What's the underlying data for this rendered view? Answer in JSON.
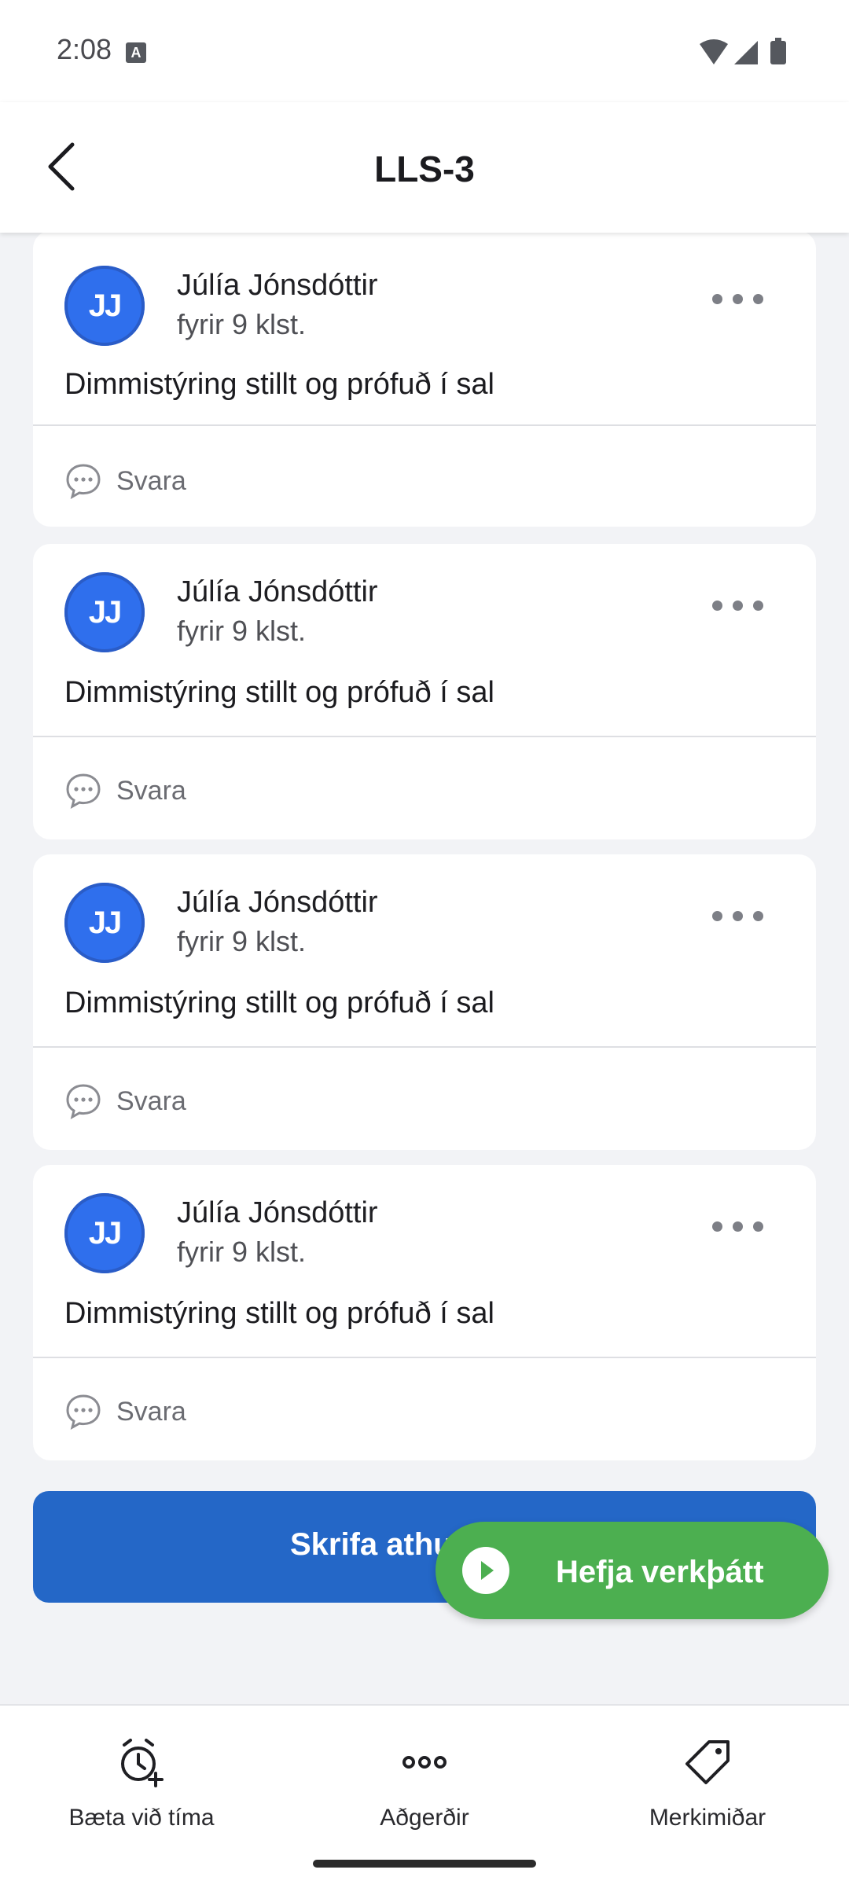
{
  "status_bar": {
    "time": "2:08",
    "notification_letter": "A"
  },
  "header": {
    "title": "LLS-3",
    "back_icon": "chevron-left-icon"
  },
  "comments": [
    {
      "initials": "JJ",
      "author": "Júlía Jónsdóttir",
      "time": "fyrir 9 klst.",
      "message": "Dimmistýring stillt og prófuð í sal",
      "reply_label": "Svara"
    },
    {
      "initials": "JJ",
      "author": "Júlía Jónsdóttir",
      "time": "fyrir 9 klst.",
      "message": "Dimmistýring stillt og prófuð í sal",
      "reply_label": "Svara"
    },
    {
      "initials": "JJ",
      "author": "Júlía Jónsdóttir",
      "time": "fyrir 9 klst.",
      "message": "Dimmistýring stillt og prófuð í sal",
      "reply_label": "Svara"
    },
    {
      "initials": "JJ",
      "author": "Júlía Jónsdóttir",
      "time": "fyrir 9 klst.",
      "message": "Dimmistýring stillt og prófuð í sal",
      "reply_label": "Svara"
    }
  ],
  "actions": {
    "write_comment_label": "Skrifa athu",
    "start_task_label": "Hefja verkþátt"
  },
  "bottom_nav": [
    {
      "label": "Bæta við tíma",
      "icon": "clock-plus-icon"
    },
    {
      "label": "Aðgerðir",
      "icon": "more-horizontal-icon"
    },
    {
      "label": "Merkimiðar",
      "icon": "tag-icon"
    }
  ],
  "colors": {
    "primary_blue": "#2467c7",
    "avatar_blue": "#2f6fed",
    "start_green": "#4caf50",
    "background": "#f2f3f6"
  }
}
